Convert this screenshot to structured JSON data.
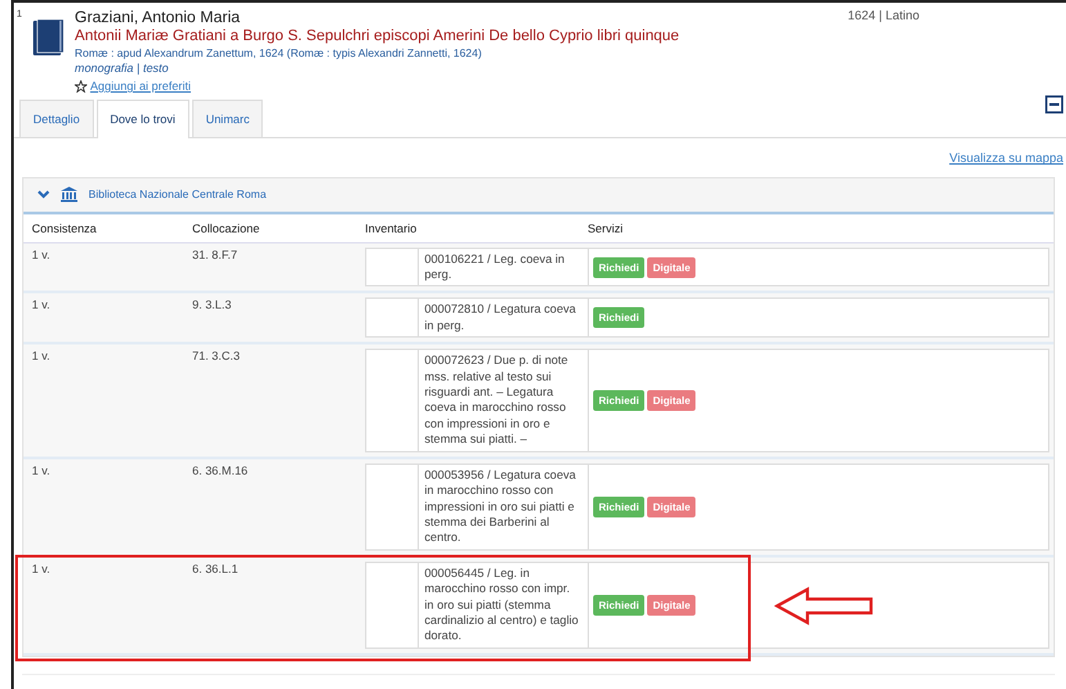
{
  "record": {
    "number": "1",
    "author": "Graziani, Antonio Maria",
    "title": "Antonii Mariæ Gratiani a Burgo S. Sepulchri episcopi Amerini De bello Cyprio libri quinque",
    "publication": "Romæ : apud Alexandrum Zanettum, 1624 (Romæ : typis Alexandri Zannetti, 1624)",
    "format": "monografia | testo",
    "favorite": "Aggiungi ai preferiti",
    "year_language": "1624 | Latino"
  },
  "tabs": [
    {
      "label": "Dettaglio",
      "selected": false
    },
    {
      "label": "Dove lo trovi",
      "selected": true
    },
    {
      "label": "Unimarc",
      "selected": false
    }
  ],
  "map_link": "Visualizza su mappa",
  "library": {
    "name": "Biblioteca Nazionale Centrale Roma",
    "expanded": true
  },
  "table": {
    "columns": [
      "Consistenza",
      "Collocazione",
      "Inventario",
      "Servizi"
    ],
    "rows": [
      {
        "consistenza": "1 v.",
        "collocazione": "31. 8.F.7",
        "inventario": "000106221 / Leg. coeva in perg.",
        "services": [
          {
            "label": "Richiedi",
            "kind": "request"
          },
          {
            "label": "Digitale",
            "kind": "digital"
          }
        ],
        "highlighted": false
      },
      {
        "consistenza": "1 v.",
        "collocazione": "9. 3.L.3",
        "inventario": "000072810 / Legatura coeva in perg.",
        "services": [
          {
            "label": "Richiedi",
            "kind": "request"
          }
        ],
        "highlighted": false
      },
      {
        "consistenza": "1 v.",
        "collocazione": "71. 3.C.3",
        "inventario": "000072623 / Due p. di note mss. relative al testo sui risguardi ant. – Legatura coeva in marocchino rosso con impressioni in oro e stemma sui piatti. –",
        "services": [
          {
            "label": "Richiedi",
            "kind": "request"
          },
          {
            "label": "Digitale",
            "kind": "digital"
          }
        ],
        "highlighted": false
      },
      {
        "consistenza": "1 v.",
        "collocazione": "6. 36.M.16",
        "inventario": "000053956 / Legatura coeva in marocchino rosso con impressioni in oro sui piatti e stemma dei Barberini al centro.",
        "services": [
          {
            "label": "Richiedi",
            "kind": "request"
          },
          {
            "label": "Digitale",
            "kind": "digital"
          }
        ],
        "highlighted": false
      },
      {
        "consistenza": "1 v.",
        "collocazione": "6. 36.L.1",
        "inventario": "000056445 / Leg. in marocchino rosso con impr. in oro sui piatti (stemma cardinalizio al centro) e taglio dorato.",
        "services": [
          {
            "label": "Richiedi",
            "kind": "request"
          },
          {
            "label": "Digitale",
            "kind": "digital"
          }
        ],
        "highlighted": true
      }
    ]
  }
}
